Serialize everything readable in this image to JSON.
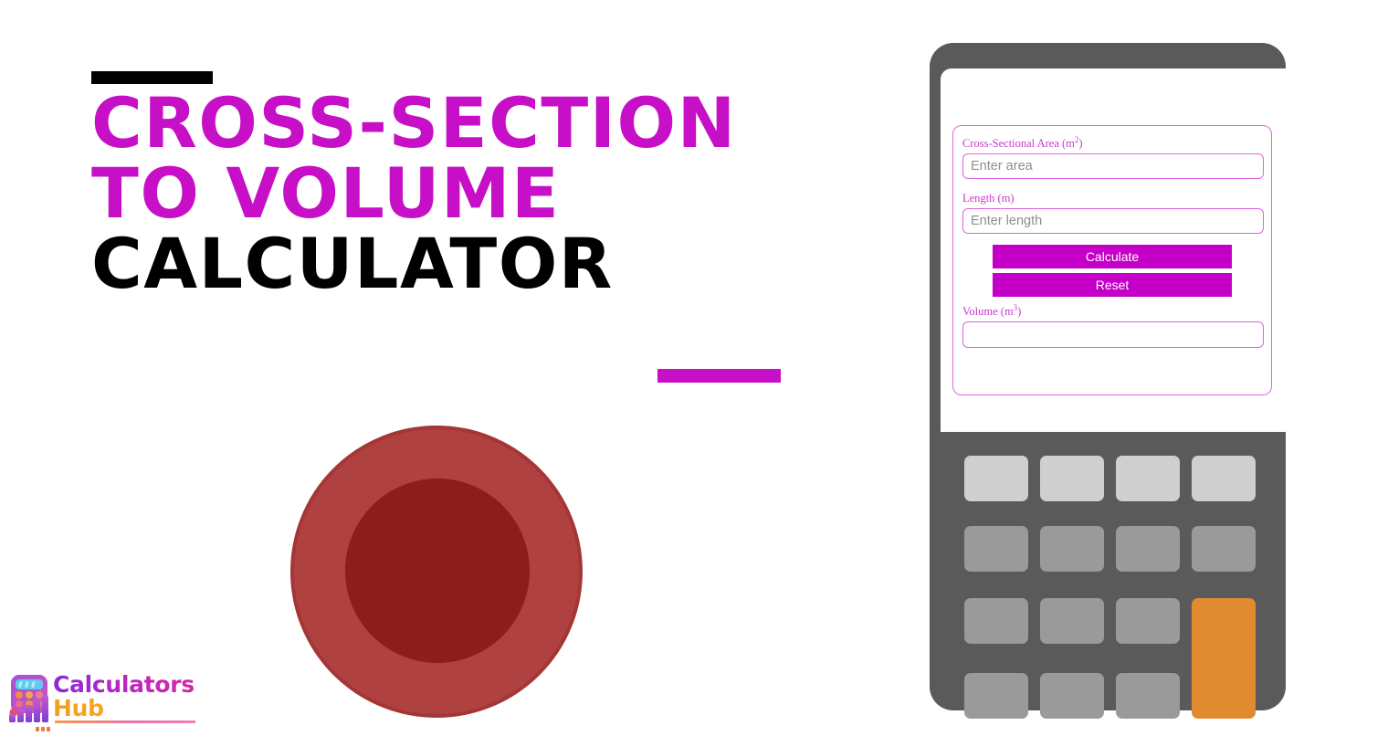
{
  "hero": {
    "title_lines": [
      "Cross-Section",
      "to Volume",
      "Calculator"
    ],
    "accent_color": "#c60fc6",
    "accent_bar_top_color": "#000000",
    "illustration": {
      "name": "cross-section-circle",
      "outer_color": "#b04141",
      "outer_border_color": "#a53636",
      "inner_color": "#8d1c1c"
    }
  },
  "logo": {
    "primary_word": "Calculators",
    "secondary_word": "Hub",
    "primary_color": "#c026c0",
    "secondary_color": "#f0a022",
    "mark_name": "calculator-bars-logo-icon"
  },
  "calculator": {
    "body_color": "#5a5a5a",
    "screen_color": "#ffffff",
    "form": {
      "fields": [
        {
          "id": "area",
          "label": "Cross-Sectional Area (m",
          "label_sup": "2",
          "label_tail": ")",
          "placeholder": "Enter area",
          "value": ""
        },
        {
          "id": "length",
          "label": "Length (m",
          "label_sup": "",
          "label_tail": ")",
          "placeholder": "Enter length",
          "value": ""
        }
      ],
      "buttons": [
        {
          "id": "calculate",
          "label": "Calculate"
        },
        {
          "id": "reset",
          "label": "Reset"
        }
      ],
      "result": {
        "label": "Volume (m",
        "label_sup": "3",
        "label_tail": ")",
        "placeholder": "",
        "value": ""
      },
      "border_color": "#e066e0",
      "label_color": "#cc38cc",
      "button_color": "#c400c8"
    },
    "keypad": {
      "light_key_color": "#cfcfcf",
      "dark_key_color": "#9a9a9a",
      "accent_key_color": "#e08b30",
      "rows": 4,
      "columns": 4
    }
  }
}
